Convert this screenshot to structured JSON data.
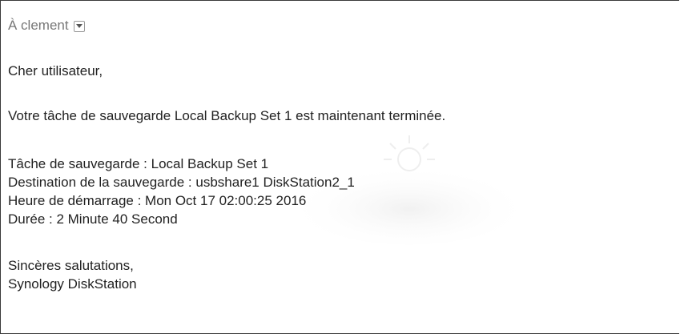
{
  "email": {
    "recipient": "À clement",
    "greeting": "Cher utilisateur,",
    "intro": "Votre tâche de sauvegarde Local Backup Set 1 est maintenant terminée.",
    "details": [
      "Tâche de sauvegarde : Local Backup Set 1",
      "Destination de la sauvegarde : usbshare1 DiskStation2_1",
      "Heure de démarrage : Mon Oct 17 02:00:25 2016",
      "Durée : 2 Minute 40 Second"
    ],
    "closing": "Sincères salutations,",
    "signature": "Synology DiskStation"
  },
  "icons": {
    "dropdown": "chevron-down-icon",
    "watermark": "sun-watermark"
  },
  "colors": {
    "text": "#222222",
    "muted": "#777777",
    "border": "#3a3a3a"
  }
}
